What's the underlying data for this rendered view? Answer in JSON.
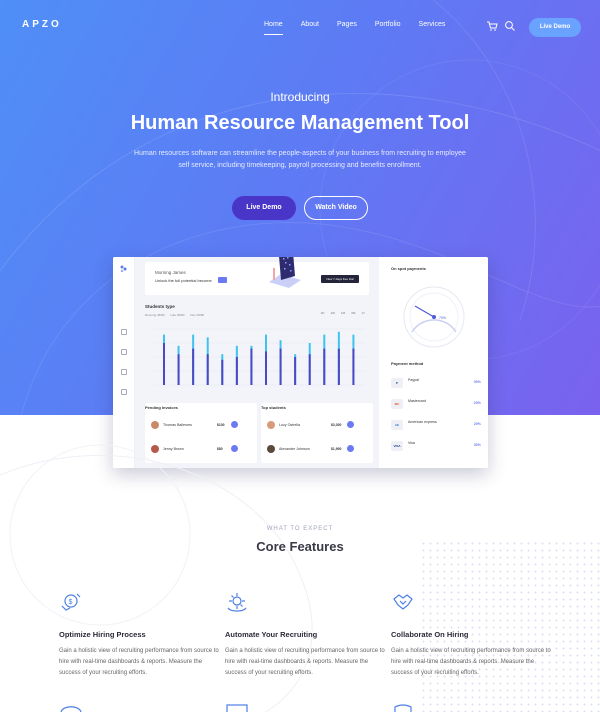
{
  "nav": {
    "logo": "APZO",
    "items": [
      "Home",
      "About",
      "Pages",
      "Portfolio",
      "Services"
    ],
    "cta": "Live Demo"
  },
  "hero": {
    "intro": "Introducing",
    "title": "Human Resource Management Tool",
    "subtitle": "Human resources software can streamline the people-aspects of your business from recruiting to employee self service, including timekeeping, payroll processing and benefits enrollment.",
    "primary_button": "Live Demo",
    "secondary_button": "Watch Video"
  },
  "dashboard": {
    "greeting_name": "Morning James",
    "greeting_msg": "Unlock the full potential become",
    "greeting_btn": "Now 7 days free trial",
    "chart": {
      "title": "Students type",
      "legend": [
        "Running 45/80",
        "Like 45/80",
        "Doc 45/80"
      ],
      "tabs": [
        "1D",
        "1W",
        "1M",
        "3M",
        "1Y"
      ],
      "bars": [
        {
          "a": 0.75,
          "b": 0.9
        },
        {
          "a": 0.55,
          "b": 0.7
        },
        {
          "a": 0.65,
          "b": 0.9
        },
        {
          "a": 0.55,
          "b": 0.85
        },
        {
          "a": 0.45,
          "b": 0.55
        },
        {
          "a": 0.5,
          "b": 0.7
        },
        {
          "a": 0.65,
          "b": 0.7
        },
        {
          "a": 0.6,
          "b": 0.9
        },
        {
          "a": 0.65,
          "b": 0.8
        },
        {
          "a": 0.5,
          "b": 0.55
        },
        {
          "a": 0.55,
          "b": 0.75
        },
        {
          "a": 0.65,
          "b": 0.9
        },
        {
          "a": 0.65,
          "b": 0.95
        },
        {
          "a": 0.65,
          "b": 0.9
        }
      ]
    },
    "pending": {
      "title": "Pending Invoices",
      "rows": [
        {
          "name": "Thomas Balleroes",
          "val": "$100"
        },
        {
          "name": "Jenny Brown",
          "val": "$80"
        }
      ]
    },
    "top": {
      "title": "Top students",
      "rows": [
        {
          "name": "Lucy Ostrella",
          "val": "$3,300"
        },
        {
          "name": "Alexander Johnson",
          "val": "$1,900"
        }
      ]
    },
    "gauge_title": "On spot payments",
    "payment_title": "Payment method",
    "payments": [
      {
        "logo": "P",
        "name": "Paypal",
        "pct": "30%",
        "color": "#1e3f9a"
      },
      {
        "logo": "MC",
        "name": "Mastercard",
        "pct": "20%",
        "color": "#e8522b"
      },
      {
        "logo": "AE",
        "name": "American express",
        "pct": "20%",
        "color": "#2e77d6"
      },
      {
        "logo": "VISA",
        "name": "Visa",
        "pct": "30%",
        "color": "#1a3a8f"
      }
    ]
  },
  "features": {
    "kicker": "WHAT TO EXPECT",
    "title": "Core Features",
    "items": [
      {
        "title": "Optimize Hiring Process",
        "desc": "Gain a holistic view of recruiting performance from source to hire with real-time dashboards & reports. Measure the success of your recruiting efforts."
      },
      {
        "title": "Automate Your Recruiting",
        "desc": "Gain a holistic view of recruiting performance from source to hire with real-time dashboards & reports. Measure the success of your recruiting efforts."
      },
      {
        "title": "Collaborate On Hiring",
        "desc": "Gain a holistic view of recruiting performance from source to hire with real-time dashboards & reports. Measure the success of your recruiting efforts."
      }
    ]
  },
  "colors": {
    "accent": "#6b7af2",
    "brand_dark": "#4a35c9",
    "icon_blue": "#4d7fe6"
  }
}
